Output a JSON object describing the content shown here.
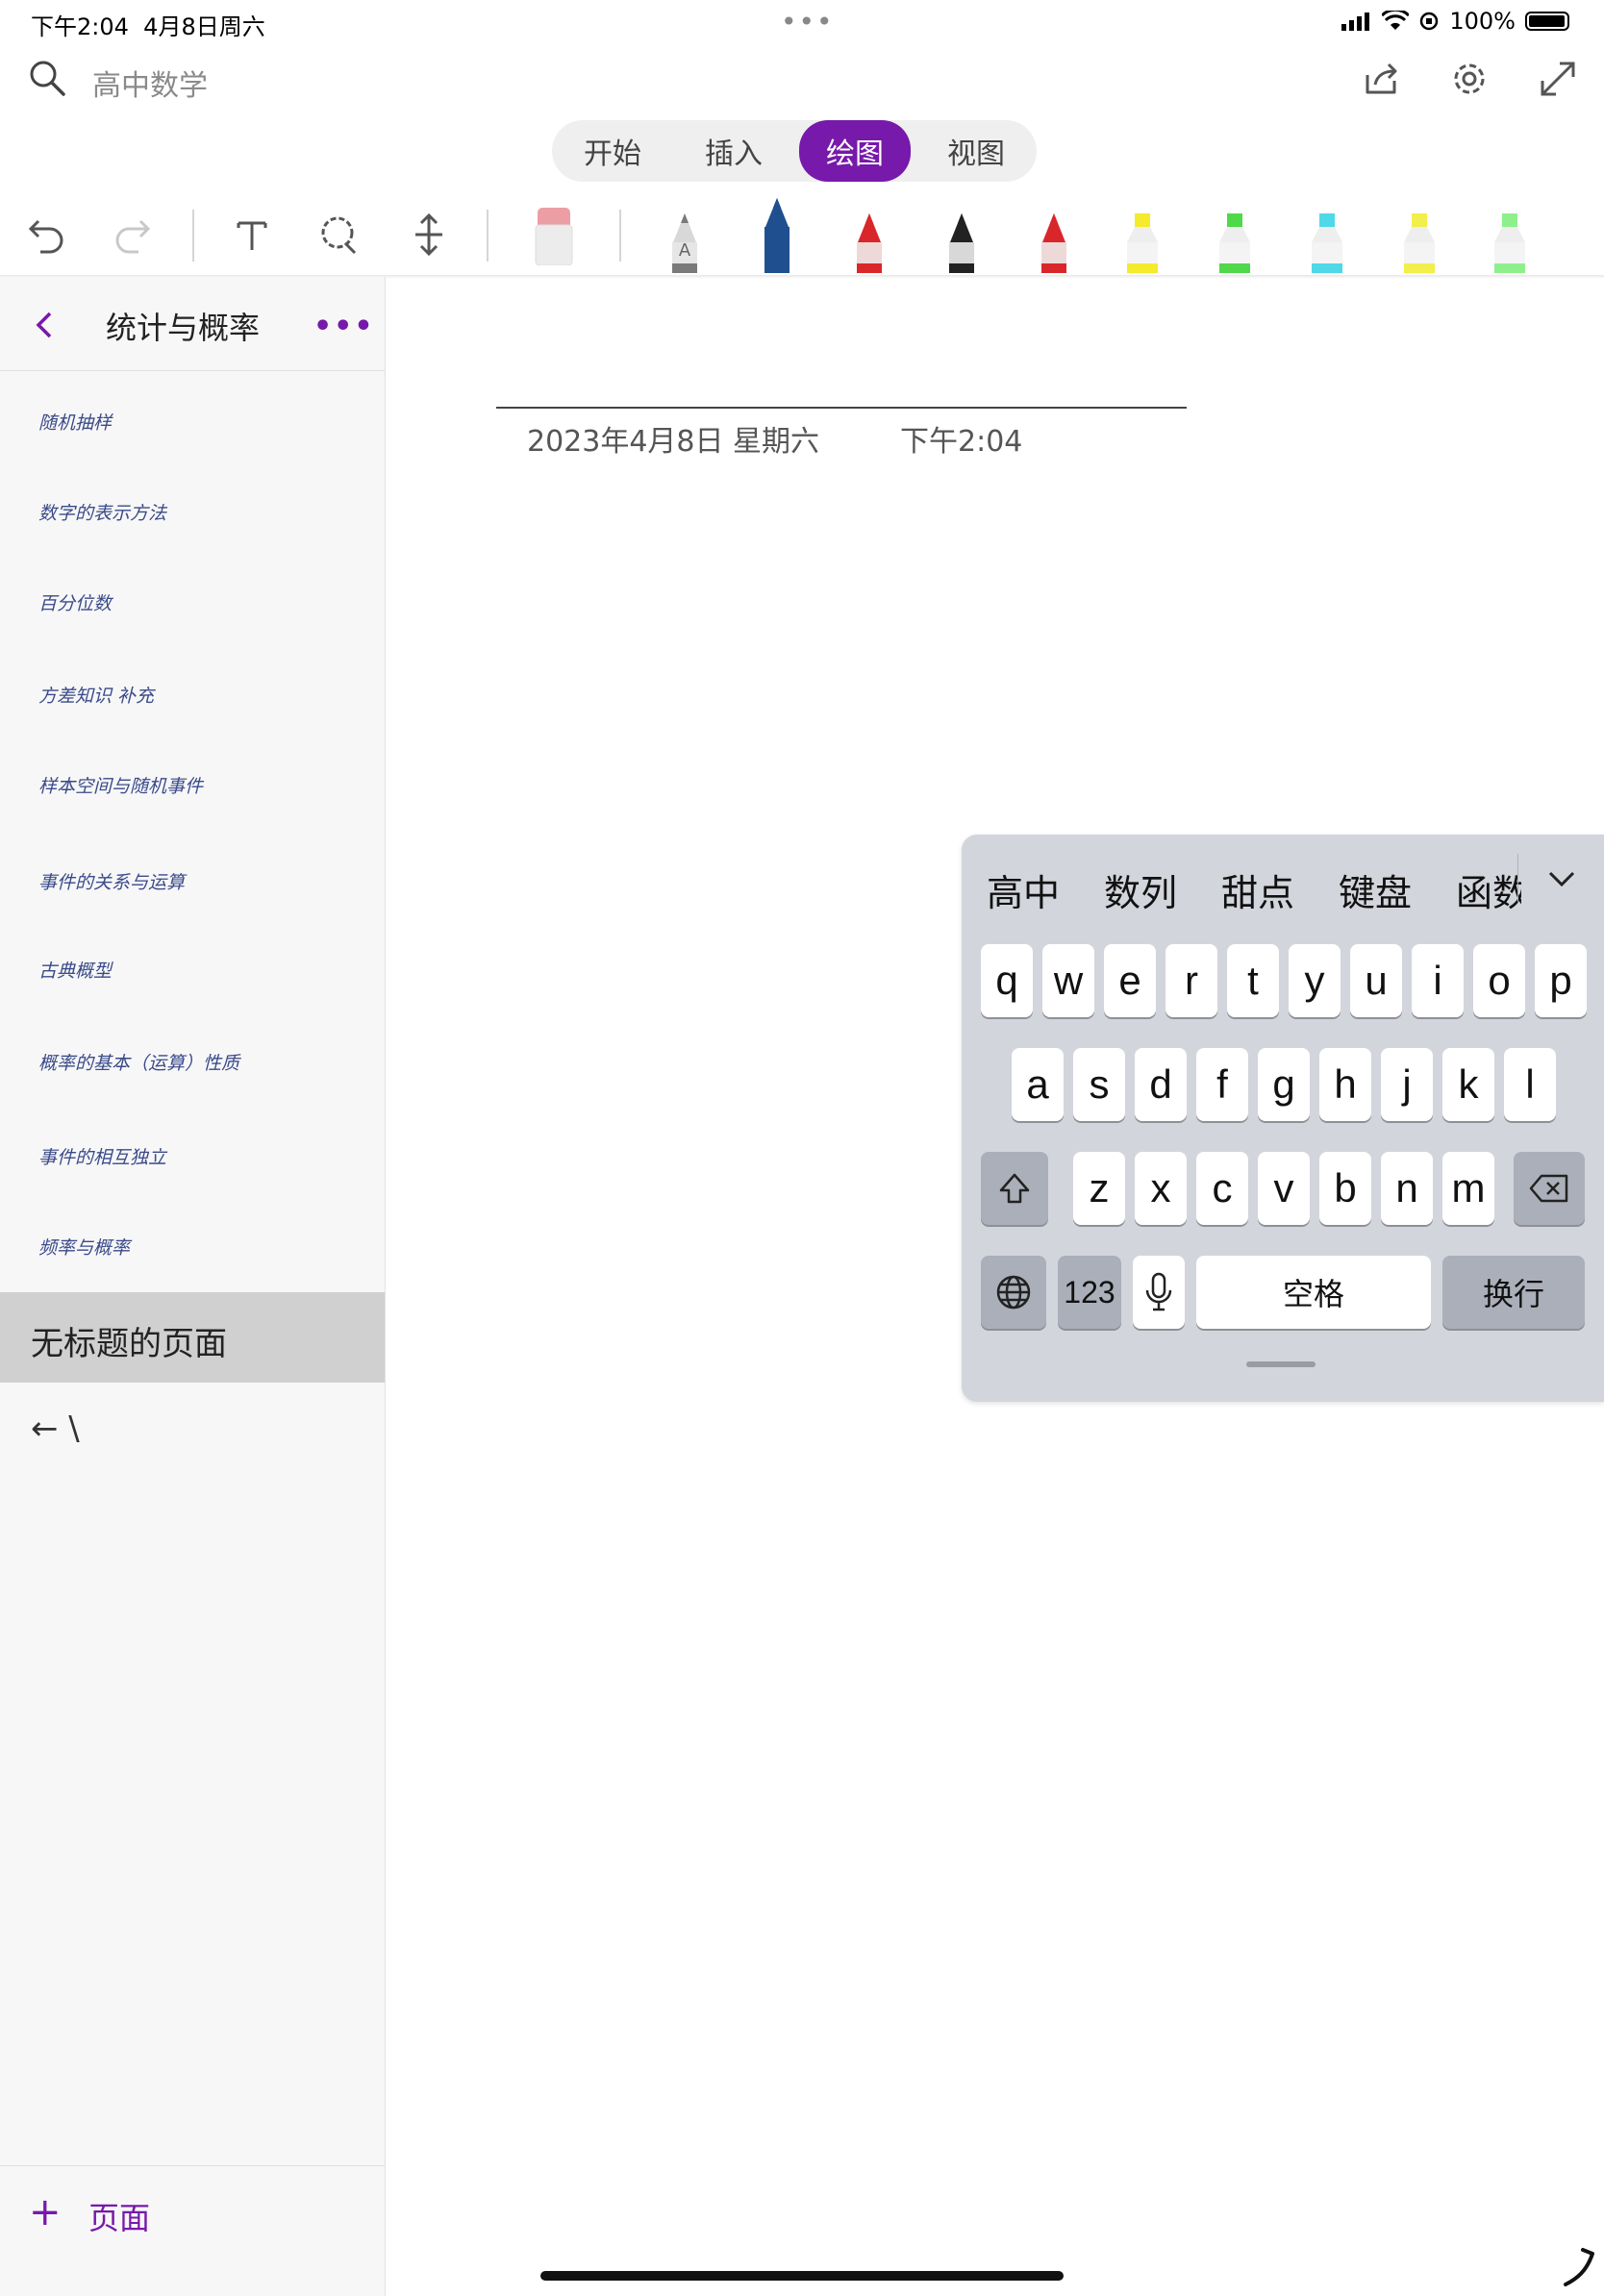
{
  "status_bar": {
    "time": "下午2:04",
    "date": "4月8日周六",
    "dots": "•••",
    "battery": "100%"
  },
  "header": {
    "notebook_title": "高中数学"
  },
  "tabs": [
    {
      "label": "开始",
      "active": false
    },
    {
      "label": "插入",
      "active": false
    },
    {
      "label": "绘图",
      "active": true
    },
    {
      "label": "视图",
      "active": false
    }
  ],
  "toolbar": {
    "tools": [
      "undo-icon",
      "redo-icon",
      "text-icon",
      "lasso-icon",
      "insert-space-icon",
      "eraser-icon"
    ],
    "pens": [
      {
        "name": "pencil-gray",
        "color": "#7a7a7a"
      },
      {
        "name": "pen-blue",
        "color": "#1f4f8f",
        "selected": true
      },
      {
        "name": "pen-red",
        "color": "#d9262b"
      },
      {
        "name": "pen-black",
        "color": "#222222"
      },
      {
        "name": "pen-red-2",
        "color": "#d9262b"
      },
      {
        "name": "highlighter-yellow",
        "color": "#f5ea2b"
      },
      {
        "name": "highlighter-green",
        "color": "#4fd84a"
      },
      {
        "name": "highlighter-cyan",
        "color": "#4fd8e8"
      },
      {
        "name": "highlighter-yellow-2",
        "color": "#f2ee4a"
      },
      {
        "name": "highlighter-light-green",
        "color": "#8ef08a"
      }
    ]
  },
  "sidebar": {
    "section_title": "统计与概率",
    "pages": [
      "随机抽样",
      "数字的表示方法",
      "百分位数",
      "方差知识 补充",
      "样本空间与随机事件",
      "事件的关系与运算",
      "古典概型",
      "概率的基本（运算）性质",
      "事件的相互独立",
      "频率与概率"
    ],
    "selected_page": "无标题的页面",
    "extra_item": "← \\",
    "add_page_label": "页面"
  },
  "canvas": {
    "date": "2023年4月8日 星期六",
    "time": "下午2:04",
    "ink_color": "#2f6fd8"
  },
  "keyboard": {
    "suggestions": [
      "高中",
      "数列",
      "甜点",
      "键盘",
      "函数"
    ],
    "row1": [
      "q",
      "w",
      "e",
      "r",
      "t",
      "y",
      "u",
      "i",
      "o",
      "p"
    ],
    "row2": [
      "a",
      "s",
      "d",
      "f",
      "g",
      "h",
      "j",
      "k",
      "l"
    ],
    "row3": [
      "z",
      "x",
      "c",
      "v",
      "b",
      "n",
      "m"
    ],
    "numbers_key": "123",
    "space_key": "空格",
    "return_key": "换行"
  }
}
